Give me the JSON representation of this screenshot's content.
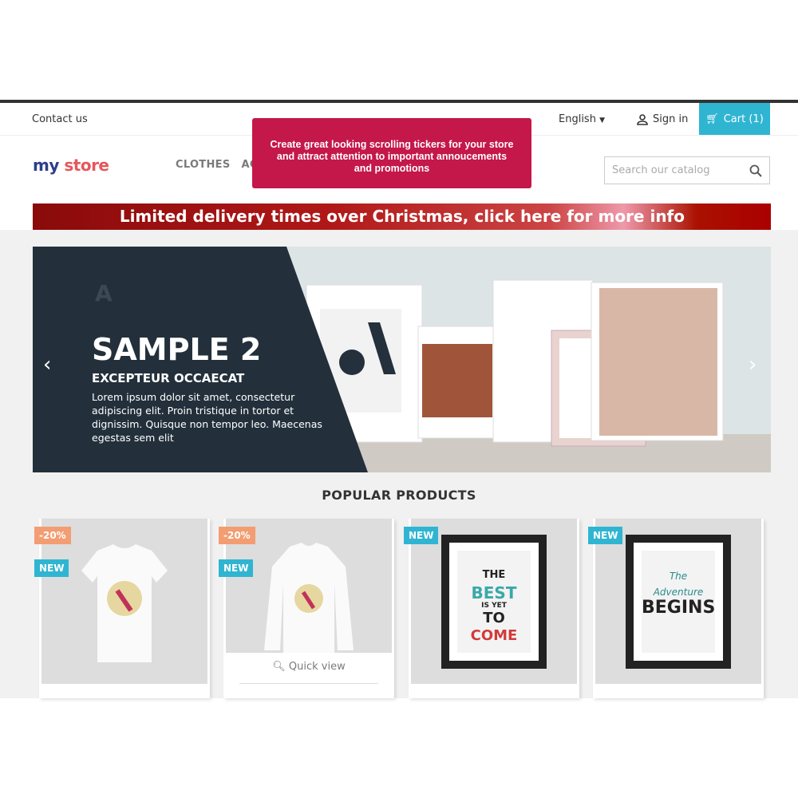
{
  "header": {
    "contact": "Contact us",
    "language": "English",
    "signin": "Sign in",
    "cart": "Cart (1)",
    "logo": {
      "part1": "my",
      "part2": "store"
    },
    "nav": [
      "CLOTHES",
      "AC"
    ],
    "search_placeholder": "Search our catalog"
  },
  "popup": {
    "line1": "Create great looking scrolling tickers for your store",
    "line2": "and attract attention to important annoucements",
    "line3": "and promotions",
    "color": "#c4174a"
  },
  "ticker": {
    "text": "Limited delivery times over Christmas, click here for more info"
  },
  "slider": {
    "title": "SAMPLE 2",
    "subtitle": "EXCEPTEUR OCCAECAT",
    "text": "Lorem ipsum dolor sit amet, consectetur adipiscing elit. Proin tristique in tortor et dignissim. Quisque non tempor leo. Maecenas egestas sem elit",
    "prev": "‹",
    "next": "›"
  },
  "products": {
    "heading": "POPULAR PRODUCTS",
    "quick_view": "Quick view",
    "items": [
      {
        "discount": "-20%",
        "badge": "NEW"
      },
      {
        "discount": "-20%",
        "badge": "NEW"
      },
      {
        "badge": "NEW",
        "poster": [
          "THE",
          "BEST",
          "IS YET",
          "TO",
          "COME"
        ]
      },
      {
        "badge": "NEW",
        "poster": [
          "The",
          "Adventure",
          "BEGINS"
        ]
      }
    ]
  },
  "colors": {
    "accent": "#2fb5d2",
    "discount": "#f39d72"
  }
}
